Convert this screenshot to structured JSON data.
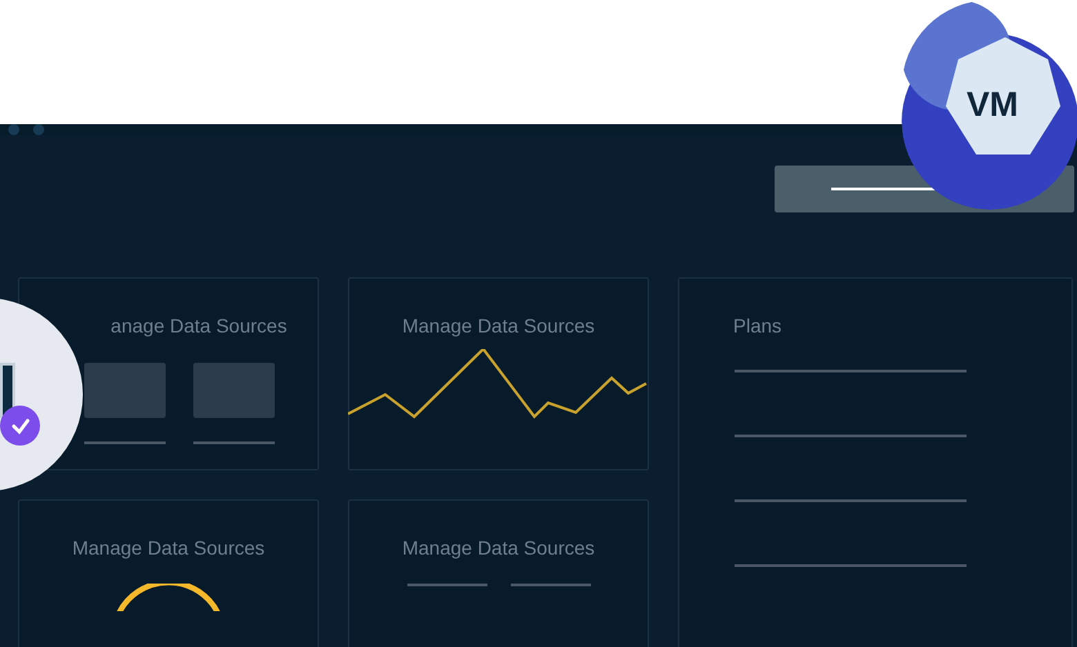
{
  "badge": {
    "text": "VM"
  },
  "cards": [
    {
      "kind": "tiles",
      "title": "anage Data Sources"
    },
    {
      "kind": "line",
      "title": "Manage Data Sources"
    },
    {
      "kind": "list",
      "title": "Plans"
    },
    {
      "kind": "gauge",
      "title": "Manage Data Sources"
    },
    {
      "kind": "lines",
      "title": "Manage Data Sources"
    }
  ]
}
